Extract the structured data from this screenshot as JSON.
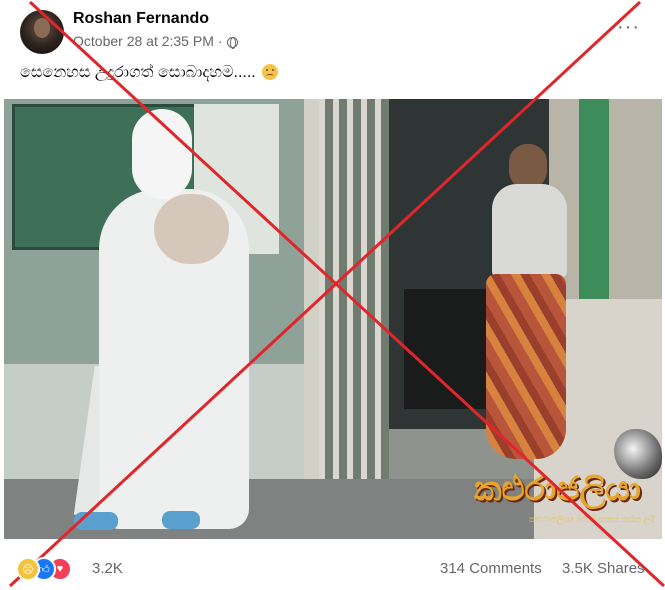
{
  "post": {
    "author": "Roshan Fernando",
    "timestamp": "October 28 at 2:35 PM",
    "separator": "·",
    "privacy_icon": "globe-icon",
    "more_icon": "ellipsis-icon",
    "more_label": "···",
    "caption": "සෙනෙහස උදුරාගත් සොබාදහම.....",
    "caption_emoji": "sad-face-emoji"
  },
  "image": {
    "watermark_text": "කළුරාජලියා",
    "watermark_subtext": "කළුරාජලියා මගින් සකස් කරන ලදී",
    "overlay": "red-x-mark",
    "overlay_color": "#e0262b"
  },
  "stats": {
    "reactions": [
      "sad-reaction-icon",
      "like-reaction-icon",
      "love-reaction-icon"
    ],
    "reaction_count": "3.2K",
    "comments": "314 Comments",
    "shares": "3.5K Shares"
  }
}
